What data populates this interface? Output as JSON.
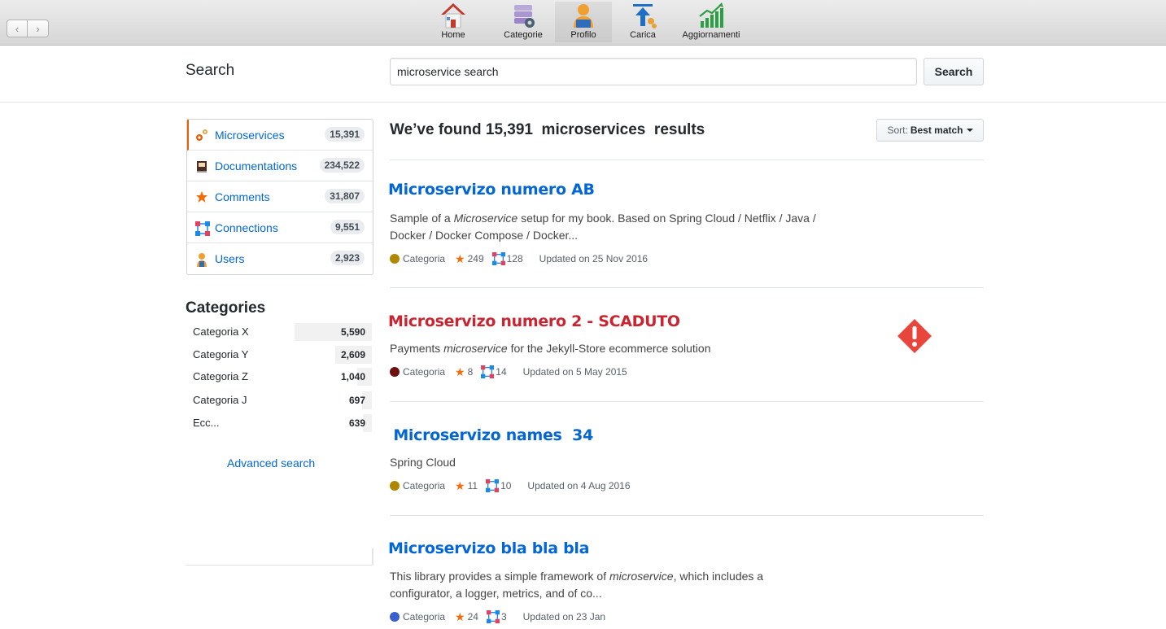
{
  "toolbar": {
    "back": "‹",
    "forward": "›",
    "items": [
      {
        "label": "Home",
        "icon": "home-icon"
      },
      {
        "label": "Categorie",
        "icon": "categories-icon"
      },
      {
        "label": "Profilo",
        "icon": "profile-icon"
      },
      {
        "label": "Carica",
        "icon": "upload-icon"
      },
      {
        "label": "Aggiornamenti",
        "icon": "updates-chart-icon"
      }
    ]
  },
  "search": {
    "title": "Search",
    "value": "microservice search",
    "button": "Search"
  },
  "menu": {
    "items": [
      {
        "label": "Microservices",
        "count": "15,391",
        "icon": "gears-icon",
        "selected": true
      },
      {
        "label": "Documentations",
        "count": "234,522",
        "icon": "book-icon"
      },
      {
        "label": "Comments",
        "count": "31,807",
        "icon": "star-icon"
      },
      {
        "label": "Connections",
        "count": "9,551",
        "icon": "network-icon"
      },
      {
        "label": "Users",
        "count": "2,923",
        "icon": "user-icon"
      }
    ]
  },
  "categories": {
    "title": "Categories",
    "items": [
      {
        "name": "Categoria X",
        "count": "5,590",
        "fill": 1.0
      },
      {
        "name": "Categoria Y",
        "count": "2,609",
        "fill": 0.47
      },
      {
        "name": "Categoria Z",
        "count": "1,040",
        "fill": 0.19
      },
      {
        "name": "Categoria J",
        "count": "697",
        "fill": 0.13
      },
      {
        "name": "Ecc...",
        "count": "639",
        "fill": 0.12
      }
    ],
    "advanced": "Advanced search"
  },
  "results": {
    "heading": "We’ve found 15,391  microservices  results",
    "sort_prefix": "Sort:",
    "sort_value": "Best match",
    "items": [
      {
        "title": "Microservizo numero AB",
        "desc_parts": [
          "Sample of a ",
          "Microservice",
          " setup for my book. Based on Spring Cloud / Netflix / Java / Docker / Docker Compose / Docker..."
        ],
        "category": "Categoria",
        "category_color": "#b08800",
        "stars": "249",
        "connections": "128",
        "updated": "Updated on 25 Nov 2016"
      },
      {
        "title": "Microservizo numero 2 - SCADUTO",
        "expired": true,
        "desc_parts": [
          "Payments ",
          "microservice",
          " for the Jekyll-Store ecommerce solution"
        ],
        "category": "Categoria",
        "category_color": "#6e1010",
        "stars": "8",
        "connections": "14",
        "updated": "Updated on 5 May 2015"
      },
      {
        "title": " Microservizo names  34",
        "desc_parts": [
          "Spring Cloud",
          "",
          ""
        ],
        "category": "Categoria",
        "category_color": "#b08800",
        "stars": "11",
        "connections": "10",
        "updated": "Updated on 4 Aug 2016"
      },
      {
        "title": "Microservizo bla bla bla",
        "desc_parts": [
          "This library provides a simple framework of ",
          "microservice",
          ", which includes a configurator, a logger, metrics, and of co..."
        ],
        "category": "Categoria",
        "category_color": "#3a5fcd",
        "stars": "24",
        "connections": "3",
        "updated": "Updated on 23 Jan"
      }
    ]
  },
  "colors": {
    "link": "#0366d6",
    "expired": "#cb2431",
    "star": "#f66a0a",
    "warning": "#e8453c"
  }
}
